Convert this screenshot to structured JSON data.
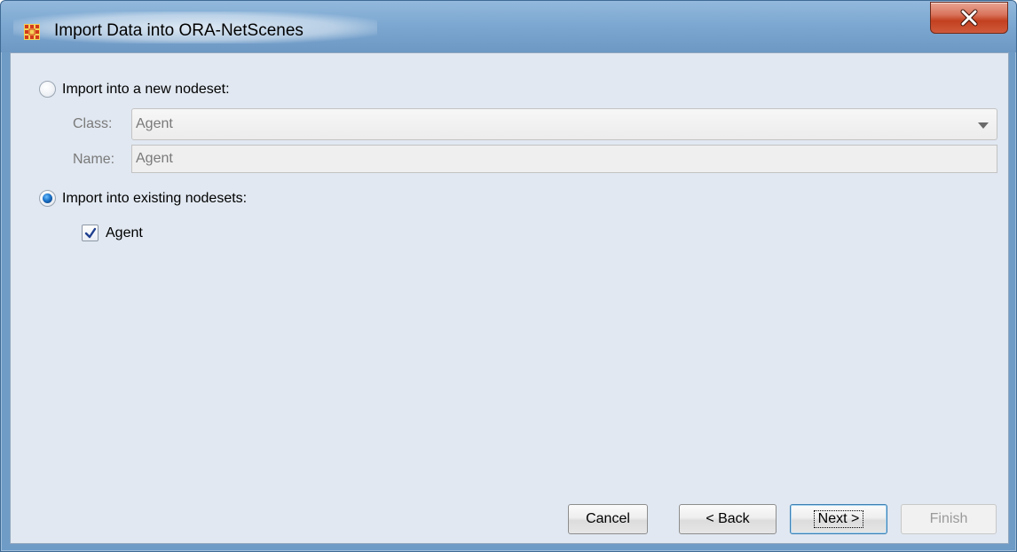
{
  "window": {
    "title": "Import Data into ORA-NetScenes",
    "app_icon": "ora-grid-icon",
    "close_icon": "close-icon"
  },
  "options": {
    "new_nodeset": {
      "label": "Import into a new nodeset:",
      "selected": false,
      "class_label": "Class:",
      "class_value": "Agent",
      "name_label": "Name:",
      "name_value": "Agent"
    },
    "existing_nodesets": {
      "label": "Import into existing nodesets:",
      "selected": true,
      "items": [
        {
          "label": "Agent",
          "checked": true
        }
      ]
    }
  },
  "buttons": {
    "cancel": "Cancel",
    "back": "< Back",
    "next": "Next >",
    "finish": "Finish"
  },
  "colors": {
    "titlebar": "#7da8d1",
    "client_bg": "#e1e8f1",
    "close_button": "#c2401f",
    "radio_selected": "#1a73c9"
  }
}
